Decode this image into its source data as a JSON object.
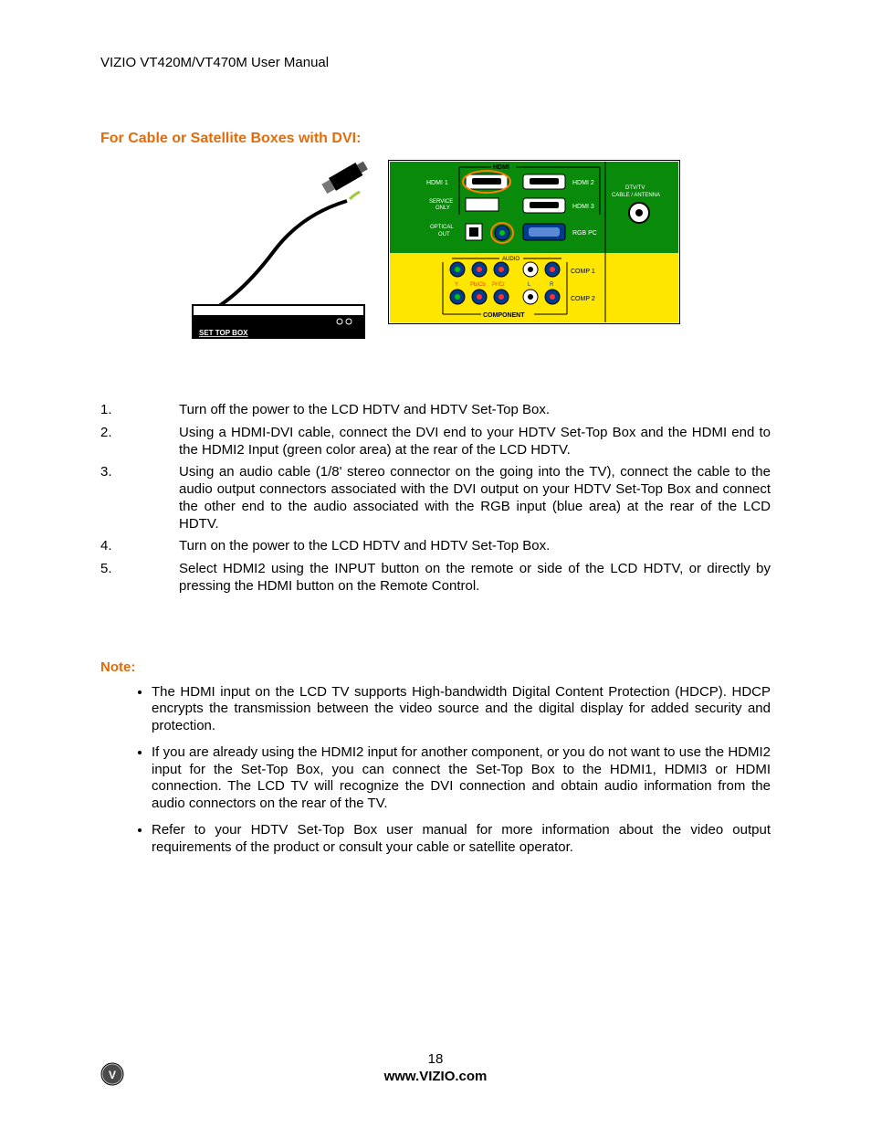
{
  "header": {
    "title": "VIZIO VT420M/VT470M User Manual"
  },
  "heading": "For Cable or Satellite Boxes with DVI:",
  "settop_label": "SET TOP BOX",
  "panel": {
    "top_label": "HDMI",
    "hdmi1": "HDMI 1",
    "hdmi2": "HDMI 2",
    "hdmi3": "HDMI 3",
    "service": "SERVICE\nONLY",
    "optical": "OPTICAL\nOUT",
    "rgb": "RGB PC",
    "dtv": "DTV/TV\nCABLE / ANTENNA",
    "audio": "AUDIO",
    "y": "Y",
    "pb": "Pb/Cb",
    "pr": "Pr/Cr",
    "l": "L",
    "r": "R",
    "comp1": "COMP 1",
    "comp2": "COMP 2",
    "component": "COMPONENT"
  },
  "steps": [
    "Turn off the power to the LCD HDTV and HDTV Set-Top Box.",
    "Using a HDMI-DVI cable, connect the DVI end to your HDTV Set-Top Box and the HDMI end to the HDMI2 Input (green color area) at the rear of the LCD HDTV.",
    "Using an audio cable (1/8' stereo connector on the going into the TV), connect the cable to the audio output connectors associated with the DVI output on your HDTV Set-Top Box and connect the other end to the audio associated with the RGB input (blue area) at the rear of the LCD HDTV.",
    "Turn on the power to the LCD HDTV and HDTV Set-Top Box.",
    "Select HDMI2 using the INPUT button on the remote or side of the LCD HDTV, or directly by pressing the HDMI button on the Remote Control."
  ],
  "note_heading": "Note:",
  "notes": [
    "The HDMI input on the LCD TV supports High-bandwidth Digital Content Protection (HDCP). HDCP encrypts the transmission between the video source and the digital display for added security and protection.",
    "If you are already using the HDMI2 input for another component, or you do not want to use the HDMI2 input for the Set-Top Box, you can connect the Set-Top Box to the HDMI1, HDMI3 or HDMI connection. The LCD TV will recognize the DVI connection and obtain audio information from the audio connectors on the rear of the TV.",
    "Refer to your HDTV Set-Top Box user manual for more information about the video output requirements of the product or consult your cable or satellite operator."
  ],
  "footer": {
    "page": "18",
    "site": "www.VIZIO.com"
  }
}
